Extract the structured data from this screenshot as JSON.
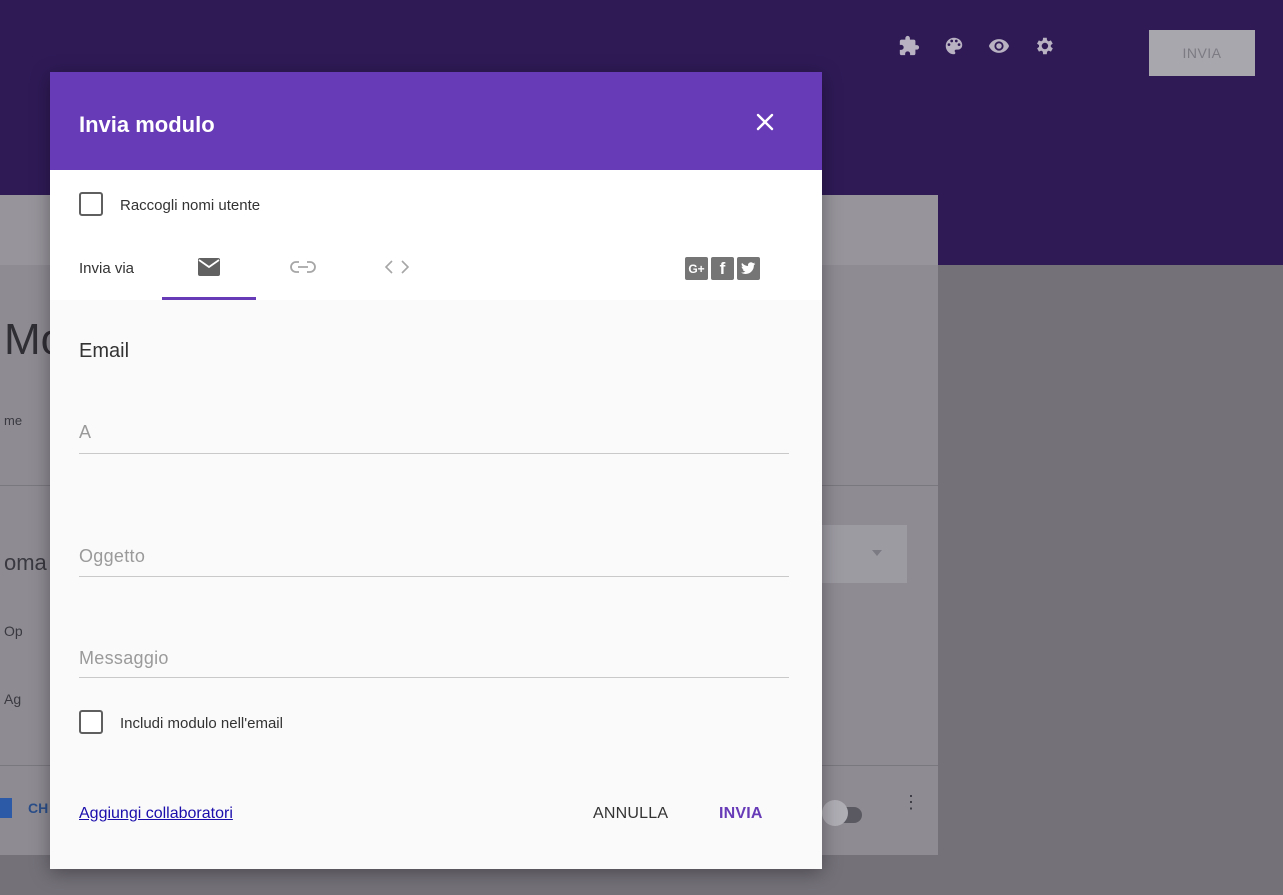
{
  "background": {
    "header_colors": {
      "header": "#2f1a56",
      "body": "#747179"
    },
    "header_icons": [
      "puzzle-icon",
      "palette-icon",
      "eye-icon",
      "gear-icon"
    ],
    "send_button_label": "INVIA",
    "fragments": {
      "title": "Mo",
      "name": "me",
      "question": "oma",
      "option1": "Op",
      "option2": "Ag",
      "checkbox_label": "CH"
    }
  },
  "dialog": {
    "title": "Invia modulo",
    "accent_color": "#673ab7",
    "collect_usernames_label": "Raccogli nomi utente",
    "send_via_label": "Invia via",
    "tabs": [
      {
        "name": "email",
        "icon": "mail-icon",
        "active": true
      },
      {
        "name": "link",
        "icon": "link-icon",
        "active": false
      },
      {
        "name": "embed",
        "icon": "code-icon",
        "active": false
      }
    ],
    "social": [
      "google-plus-icon",
      "facebook-icon",
      "twitter-icon"
    ],
    "section_title": "Email",
    "fields": {
      "to_placeholder": "A",
      "subject_placeholder": "Oggetto",
      "message_placeholder": "Messaggio"
    },
    "include_form_label": "Includi modulo nell'email",
    "add_collaborators_link": "Aggiungi collaboratori",
    "cancel_button": "ANNULLA",
    "send_button": "INVIA"
  }
}
